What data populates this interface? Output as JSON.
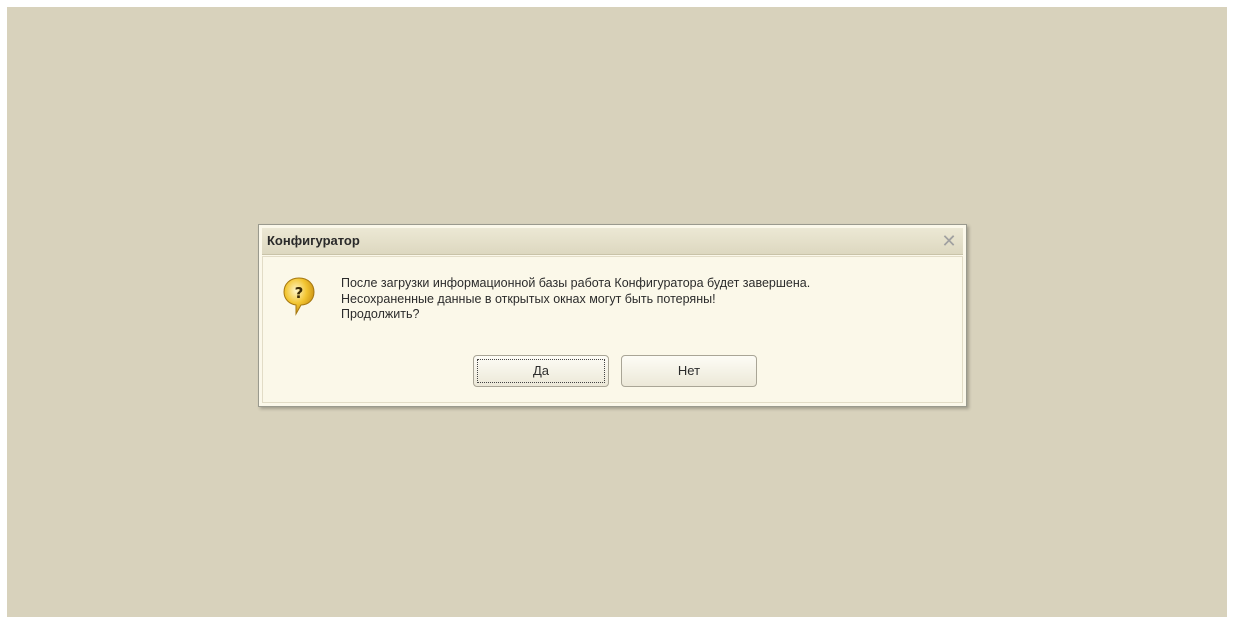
{
  "dialog": {
    "title": "Конфигуратор",
    "close_icon": "close-icon",
    "icon": "question-icon",
    "message_lines": [
      "После загрузки информационной базы работа Конфигуратора будет завершена.",
      "Несохраненные данные в открытых окнах могут быть потеряны!",
      "Продолжить?"
    ],
    "buttons": {
      "yes": "Да",
      "no": "Нет"
    }
  },
  "colors": {
    "desktop": "#d8d2bc",
    "dialog_bg": "#fbf8ea",
    "icon_yellow": "#f2c531"
  }
}
